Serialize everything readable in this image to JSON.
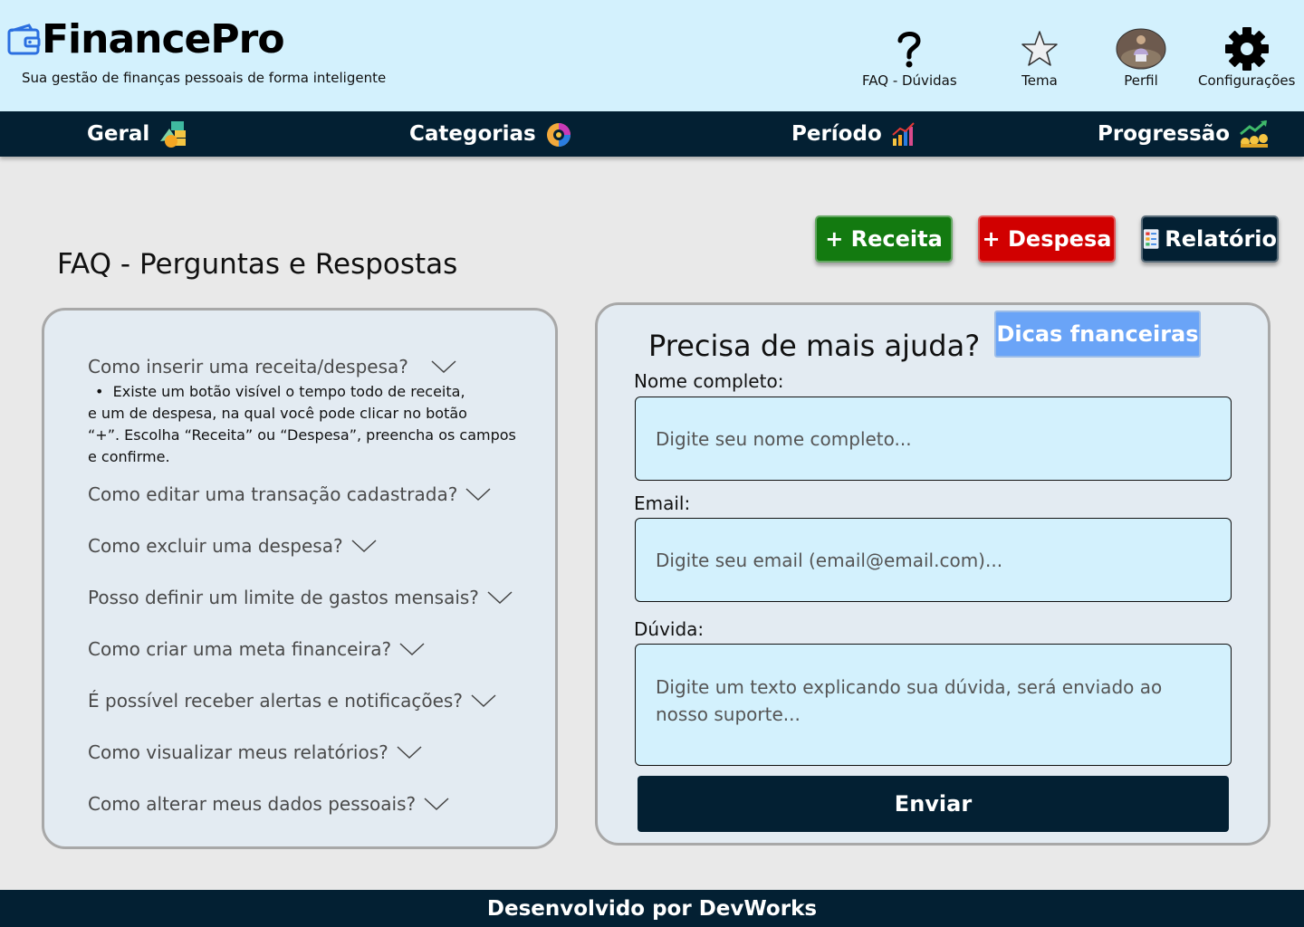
{
  "header": {
    "brand": "FinancePro",
    "tagline": "Sua gestão de finanças pessoais de forma inteligente",
    "links": [
      {
        "label": "FAQ - Dúvidas",
        "icon": "question-icon"
      },
      {
        "label": "Tema",
        "icon": "star-icon"
      },
      {
        "label": "Perfil",
        "icon": "avatar"
      },
      {
        "label": "Configurações",
        "icon": "gear-icon"
      }
    ]
  },
  "nav": {
    "items": [
      {
        "label": "Geral",
        "icon": "coins-icon"
      },
      {
        "label": "Categorias",
        "icon": "pie-chart-icon"
      },
      {
        "label": "Período",
        "icon": "bar-chart-icon"
      },
      {
        "label": "Progressão",
        "icon": "growth-chart-icon"
      }
    ]
  },
  "actions": {
    "income": "+ Receita",
    "expense": "+ Despesa",
    "report": "Relatório"
  },
  "colors": {
    "header_bg": "#d3f1fd",
    "navy": "#032033",
    "income_green": "#137a10",
    "expense_red": "#d10000",
    "tips_blue": "#6aa4f7"
  },
  "page": {
    "title": "FAQ - Perguntas e Respostas"
  },
  "faq": {
    "questions": [
      "Como inserir uma receita/despesa?",
      "Como editar uma transação cadastrada?",
      "Como excluir uma despesa?",
      "Posso definir um limite de gastos mensais?",
      "Como criar uma meta financeira?",
      "É possível receber alertas e notificações?",
      "Como visualizar meus relatórios?",
      "Como alterar meus dados pessoais?"
    ],
    "answer_lines": [
      "Existe um botão visível o tempo todo de receita,",
      "e um de despesa, na qual você pode clicar no botão",
      "“+”. Escolha “Receita” ou “Despesa”, preencha os campos",
      "e confirme."
    ]
  },
  "help": {
    "title": "Precisa de mais ajuda?",
    "tips_button": "Dicas fnanceiras",
    "name_label": "Nome completo:",
    "name_placeholder": "Digite seu nome completo...",
    "email_label": "Email:",
    "email_placeholder": "Digite seu email (email@email.com)...",
    "question_label": "Dúvida:",
    "question_placeholder_1": "Digite um texto explicando sua dúvida, será enviado ao",
    "question_placeholder_2": "nosso suporte...",
    "submit": "Enviar"
  },
  "footer": {
    "text": "Desenvolvido por DevWorks"
  }
}
